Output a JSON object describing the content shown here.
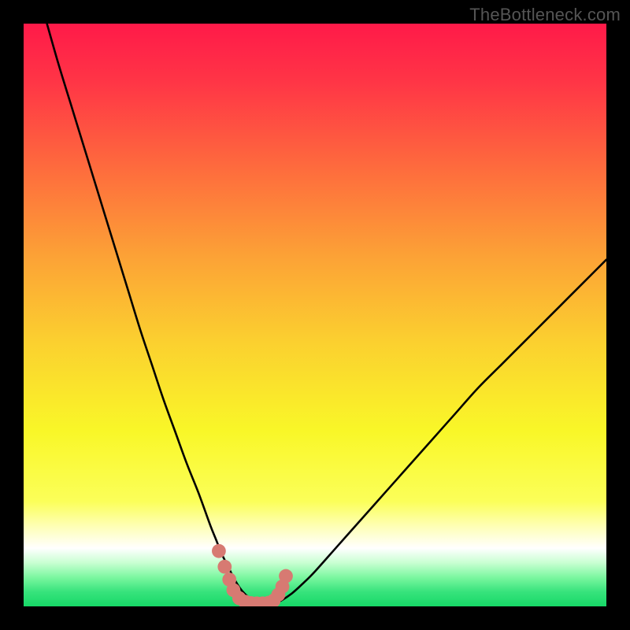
{
  "watermark": {
    "text": "TheBottleneck.com"
  },
  "colors": {
    "black": "#000000",
    "curve": "#000000",
    "marker": "#d77a72",
    "gradient_stops": [
      {
        "offset": 0.0,
        "color": "#ff1a49"
      },
      {
        "offset": 0.1,
        "color": "#ff3546"
      },
      {
        "offset": 0.25,
        "color": "#fe6c3d"
      },
      {
        "offset": 0.4,
        "color": "#fca236"
      },
      {
        "offset": 0.55,
        "color": "#fbd12f"
      },
      {
        "offset": 0.7,
        "color": "#f9f728"
      },
      {
        "offset": 0.82,
        "color": "#fbff59"
      },
      {
        "offset": 0.86,
        "color": "#feffb0"
      },
      {
        "offset": 0.9,
        "color": "#ffffff"
      },
      {
        "offset": 0.925,
        "color": "#c9ffd2"
      },
      {
        "offset": 0.95,
        "color": "#7cf7a0"
      },
      {
        "offset": 0.975,
        "color": "#37e37c"
      },
      {
        "offset": 1.0,
        "color": "#17d867"
      }
    ]
  },
  "chart_data": {
    "type": "line",
    "title": "",
    "xlabel": "",
    "ylabel": "",
    "xlim": [
      0,
      100
    ],
    "ylim": [
      0,
      100
    ],
    "series": [
      {
        "name": "bottleneck-curve",
        "x": [
          4,
          6,
          8,
          10,
          12,
          14,
          16,
          18,
          20,
          22,
          24,
          26,
          28,
          30,
          32,
          33,
          34,
          35,
          36,
          37,
          38,
          39,
          40,
          41,
          42,
          43,
          44,
          46,
          48,
          50,
          54,
          58,
          62,
          66,
          70,
          74,
          78,
          82,
          86,
          90,
          94,
          98,
          100
        ],
        "values": [
          100,
          93,
          86.5,
          80,
          73.5,
          67,
          60.5,
          54,
          47.5,
          41.5,
          35.5,
          30,
          24.5,
          19.5,
          14,
          11.5,
          9,
          7,
          5,
          3.3,
          2.1,
          1.3,
          0.8,
          0.6,
          0.55,
          0.6,
          0.9,
          2.2,
          4,
          6,
          10.5,
          15,
          19.5,
          24,
          28.5,
          33,
          37.5,
          41.5,
          45.5,
          49.5,
          53.5,
          57.5,
          59.5
        ]
      }
    ],
    "markers": {
      "name": "bottleneck-floor-markers",
      "x": [
        33.5,
        34.5,
        35.3,
        36.0,
        37.0,
        38.0,
        39.0,
        40.0,
        41.0,
        42.0,
        42.9,
        43.7,
        44.4,
        45.0
      ],
      "values": [
        9.5,
        6.8,
        4.6,
        2.8,
        1.4,
        0.8,
        0.55,
        0.5,
        0.5,
        0.6,
        1.0,
        2.0,
        3.4,
        5.2
      ],
      "point_radius": 1.2
    }
  }
}
